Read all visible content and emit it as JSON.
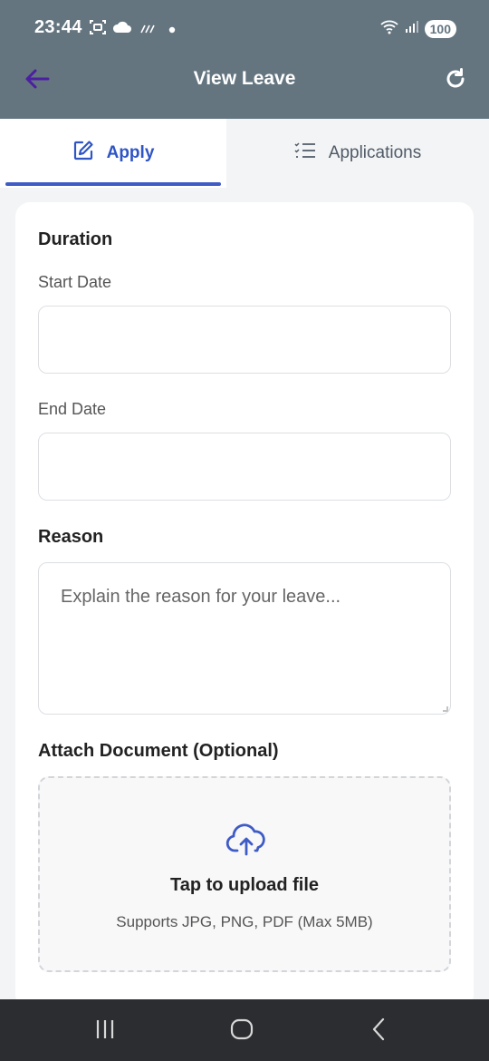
{
  "status_bar": {
    "time": "23:44",
    "battery": "100",
    "icons": [
      "screenshot-icon",
      "cloud-icon",
      "rain-icon",
      "notification-dot-icon",
      "wifi-icon",
      "signal-icon"
    ]
  },
  "app_bar": {
    "title": "View Leave",
    "back_icon": "arrow-left-icon",
    "refresh_icon": "refresh-icon",
    "back_color": "#4b1fa0"
  },
  "tabs": [
    {
      "label": "Apply",
      "icon": "edit-icon",
      "active": true
    },
    {
      "label": "Applications",
      "icon": "list-icon",
      "active": false
    }
  ],
  "form": {
    "duration_title": "Duration",
    "start_date": {
      "label": "Start Date",
      "value": ""
    },
    "end_date": {
      "label": "End Date",
      "value": ""
    },
    "reason_title": "Reason",
    "reason_placeholder": "Explain the reason for your leave...",
    "attach_title": "Attach Document (Optional)",
    "upload": {
      "icon": "cloud-upload-icon",
      "title": "Tap to upload file",
      "hint": "Supports JPG, PNG, PDF (Max 5MB)"
    }
  },
  "nav_bar": {
    "recents_icon": "recents-icon",
    "home_icon": "home-icon",
    "back_icon": "back-chevron-icon"
  },
  "colors": {
    "header": "#647580",
    "accent": "#3f5bc6",
    "nav_bar": "#2b2d30"
  }
}
